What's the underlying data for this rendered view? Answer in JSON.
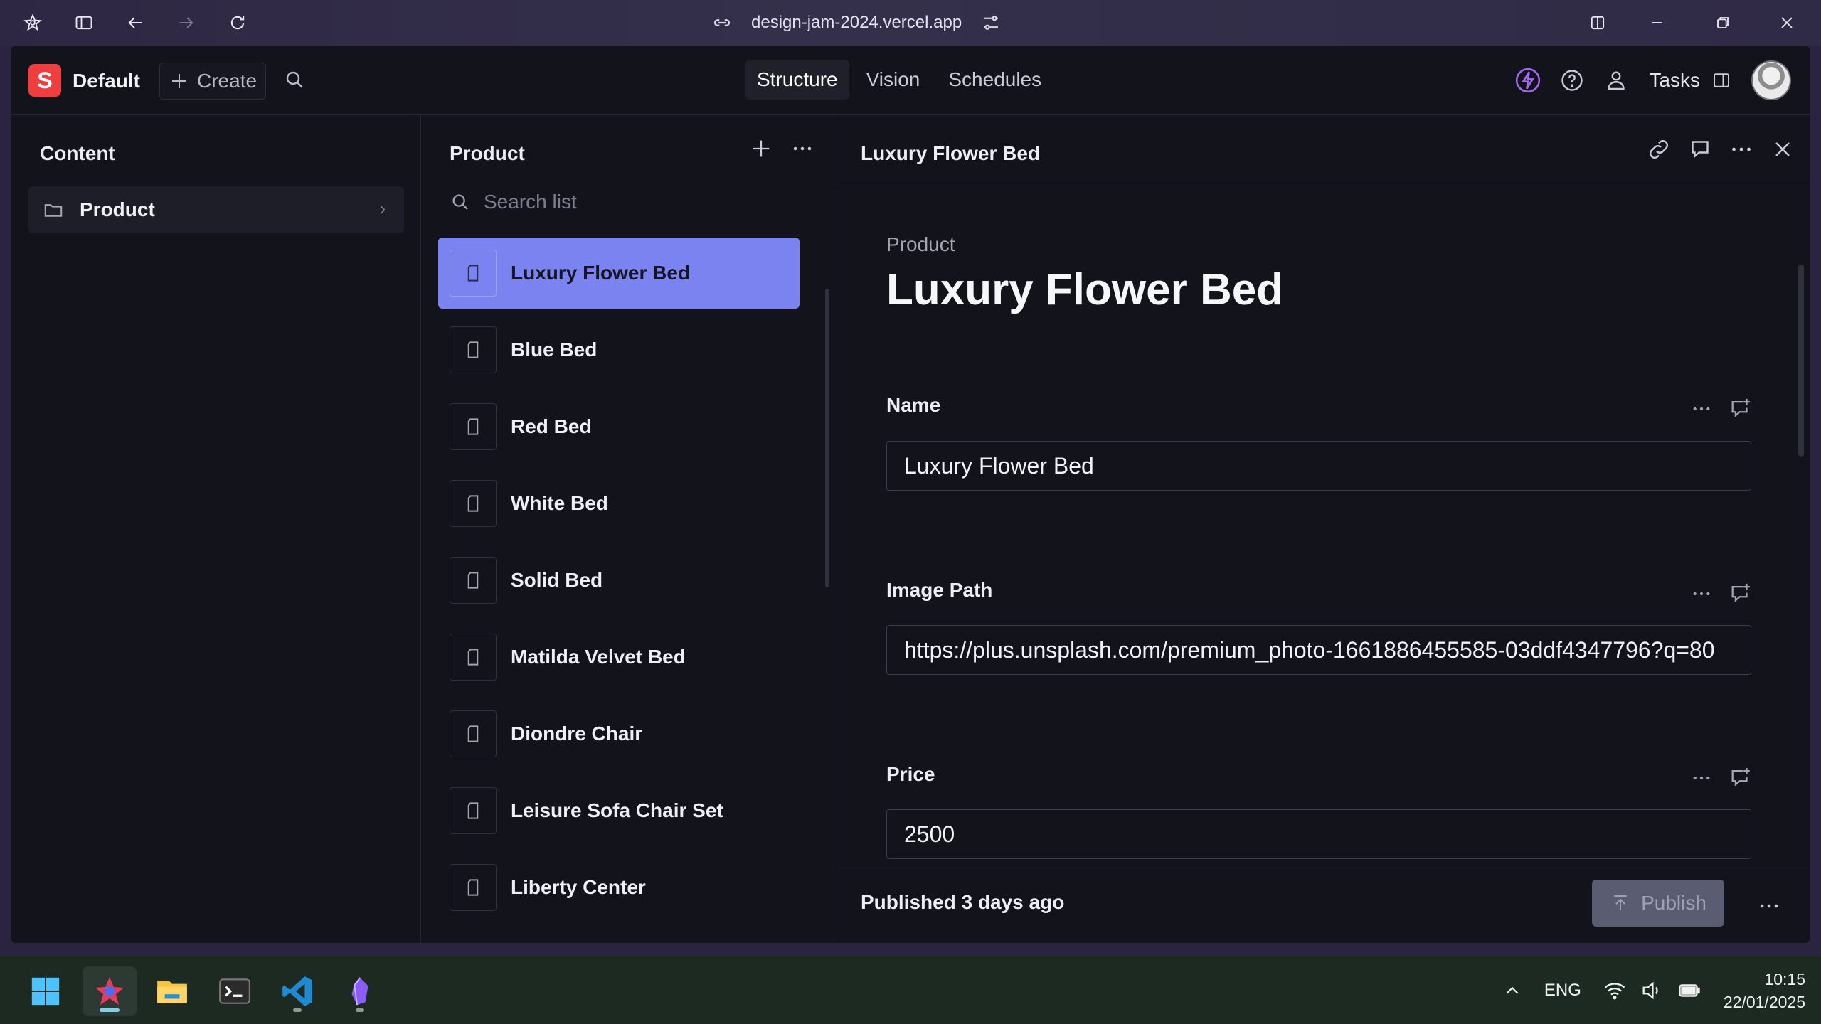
{
  "browser": {
    "url": "design-jam-2024.vercel.app"
  },
  "header": {
    "logo_letter": "S",
    "workspace": "Default",
    "create_label": "Create",
    "tabs": [
      {
        "label": "Structure",
        "active": true
      },
      {
        "label": "Vision",
        "active": false
      },
      {
        "label": "Schedules",
        "active": false
      }
    ],
    "tasks_label": "Tasks"
  },
  "content_pane": {
    "title": "Content",
    "items": [
      {
        "label": "Product"
      }
    ]
  },
  "list_pane": {
    "title": "Product",
    "search_placeholder": "Search list",
    "items": [
      {
        "label": "Luxury Flower Bed",
        "selected": true
      },
      {
        "label": "Blue Bed"
      },
      {
        "label": "Red Bed"
      },
      {
        "label": "White Bed"
      },
      {
        "label": "Solid Bed"
      },
      {
        "label": "Matilda Velvet Bed"
      },
      {
        "label": "Diondre Chair"
      },
      {
        "label": "Leisure Sofa Chair Set"
      },
      {
        "label": "Liberty Center"
      }
    ]
  },
  "document": {
    "header_title": "Luxury Flower Bed",
    "type_label": "Product",
    "heading": "Luxury Flower Bed",
    "fields": [
      {
        "label": "Name",
        "value": "Luxury Flower Bed"
      },
      {
        "label": "Image Path",
        "value": "https://plus.unsplash.com/premium_photo-1661886455585-03ddf4347796?q=80"
      },
      {
        "label": "Price",
        "value": "2500"
      }
    ],
    "status": "Published 3 days ago",
    "publish_label": "Publish"
  },
  "taskbar": {
    "language": "ENG",
    "time": "10:15",
    "date": "22/01/2025"
  },
  "colors": {
    "accent": "#7b83f0",
    "logo": "#f03e3f",
    "background": "#13141b"
  }
}
